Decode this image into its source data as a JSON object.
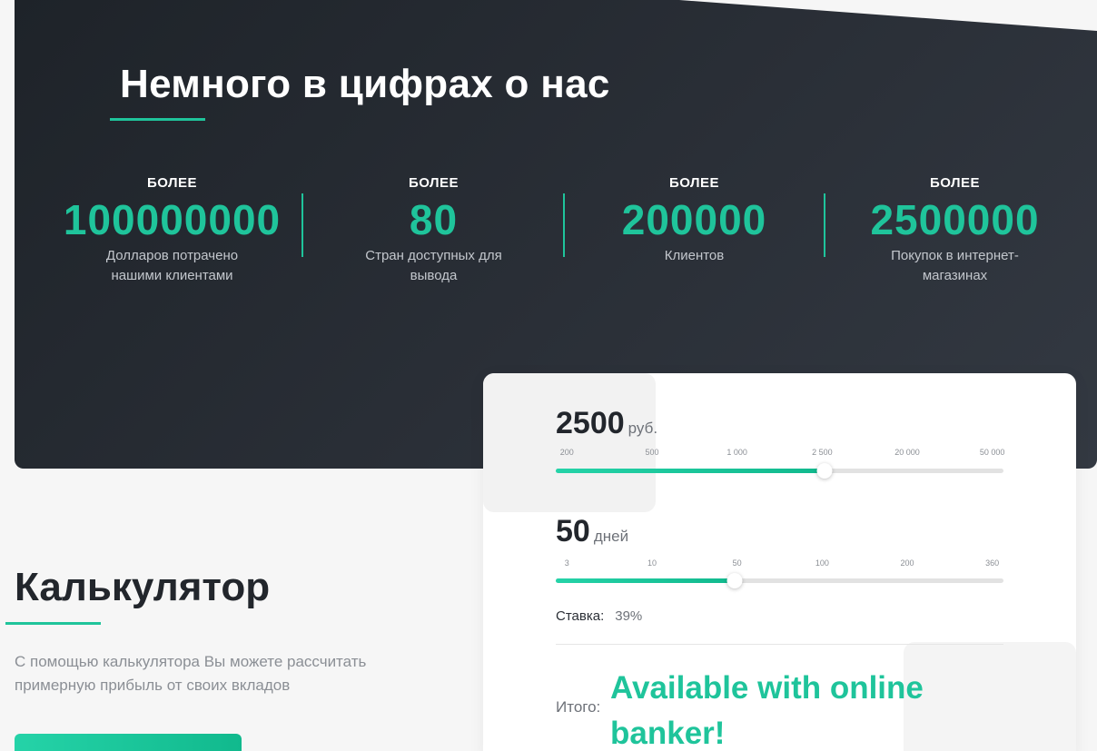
{
  "hero": {
    "title": "Немного в цифрах о нас",
    "stats": [
      {
        "prefix": "БОЛЕЕ",
        "value": "100000000",
        "desc": "Долларов потрачено нашими клиентами"
      },
      {
        "prefix": "БОЛЕЕ",
        "value": "80",
        "desc": "Стран доступных для вывода"
      },
      {
        "prefix": "БОЛЕЕ",
        "value": "200000",
        "desc": "Клиентов"
      },
      {
        "prefix": "БОЛЕЕ",
        "value": "2500000",
        "desc": "Покупок в интернет-магазинах"
      }
    ]
  },
  "calculator": {
    "title": "Калькулятор",
    "description": "С помощью калькулятора Вы можете рассчитать примерную прибыль от своих вкладов",
    "button_label": "",
    "amount": {
      "value": "2500",
      "unit": "руб.",
      "ticks": [
        "200",
        "500",
        "1 000",
        "2 500",
        "20 000",
        "50 000"
      ],
      "position_fraction": 0.6
    },
    "days": {
      "value": "50",
      "unit": "дней",
      "ticks": [
        "3",
        "10",
        "50",
        "100",
        "200",
        "360"
      ],
      "position_fraction": 0.4
    },
    "rate_label": "Ставка:",
    "rate_value": "39%",
    "total_label": "Итого:"
  },
  "overlay_text": "Available with online banker!",
  "colors": {
    "accent": "#1fc49b",
    "hero_bg": "#23282f",
    "page_bg": "#f6f6f6"
  }
}
